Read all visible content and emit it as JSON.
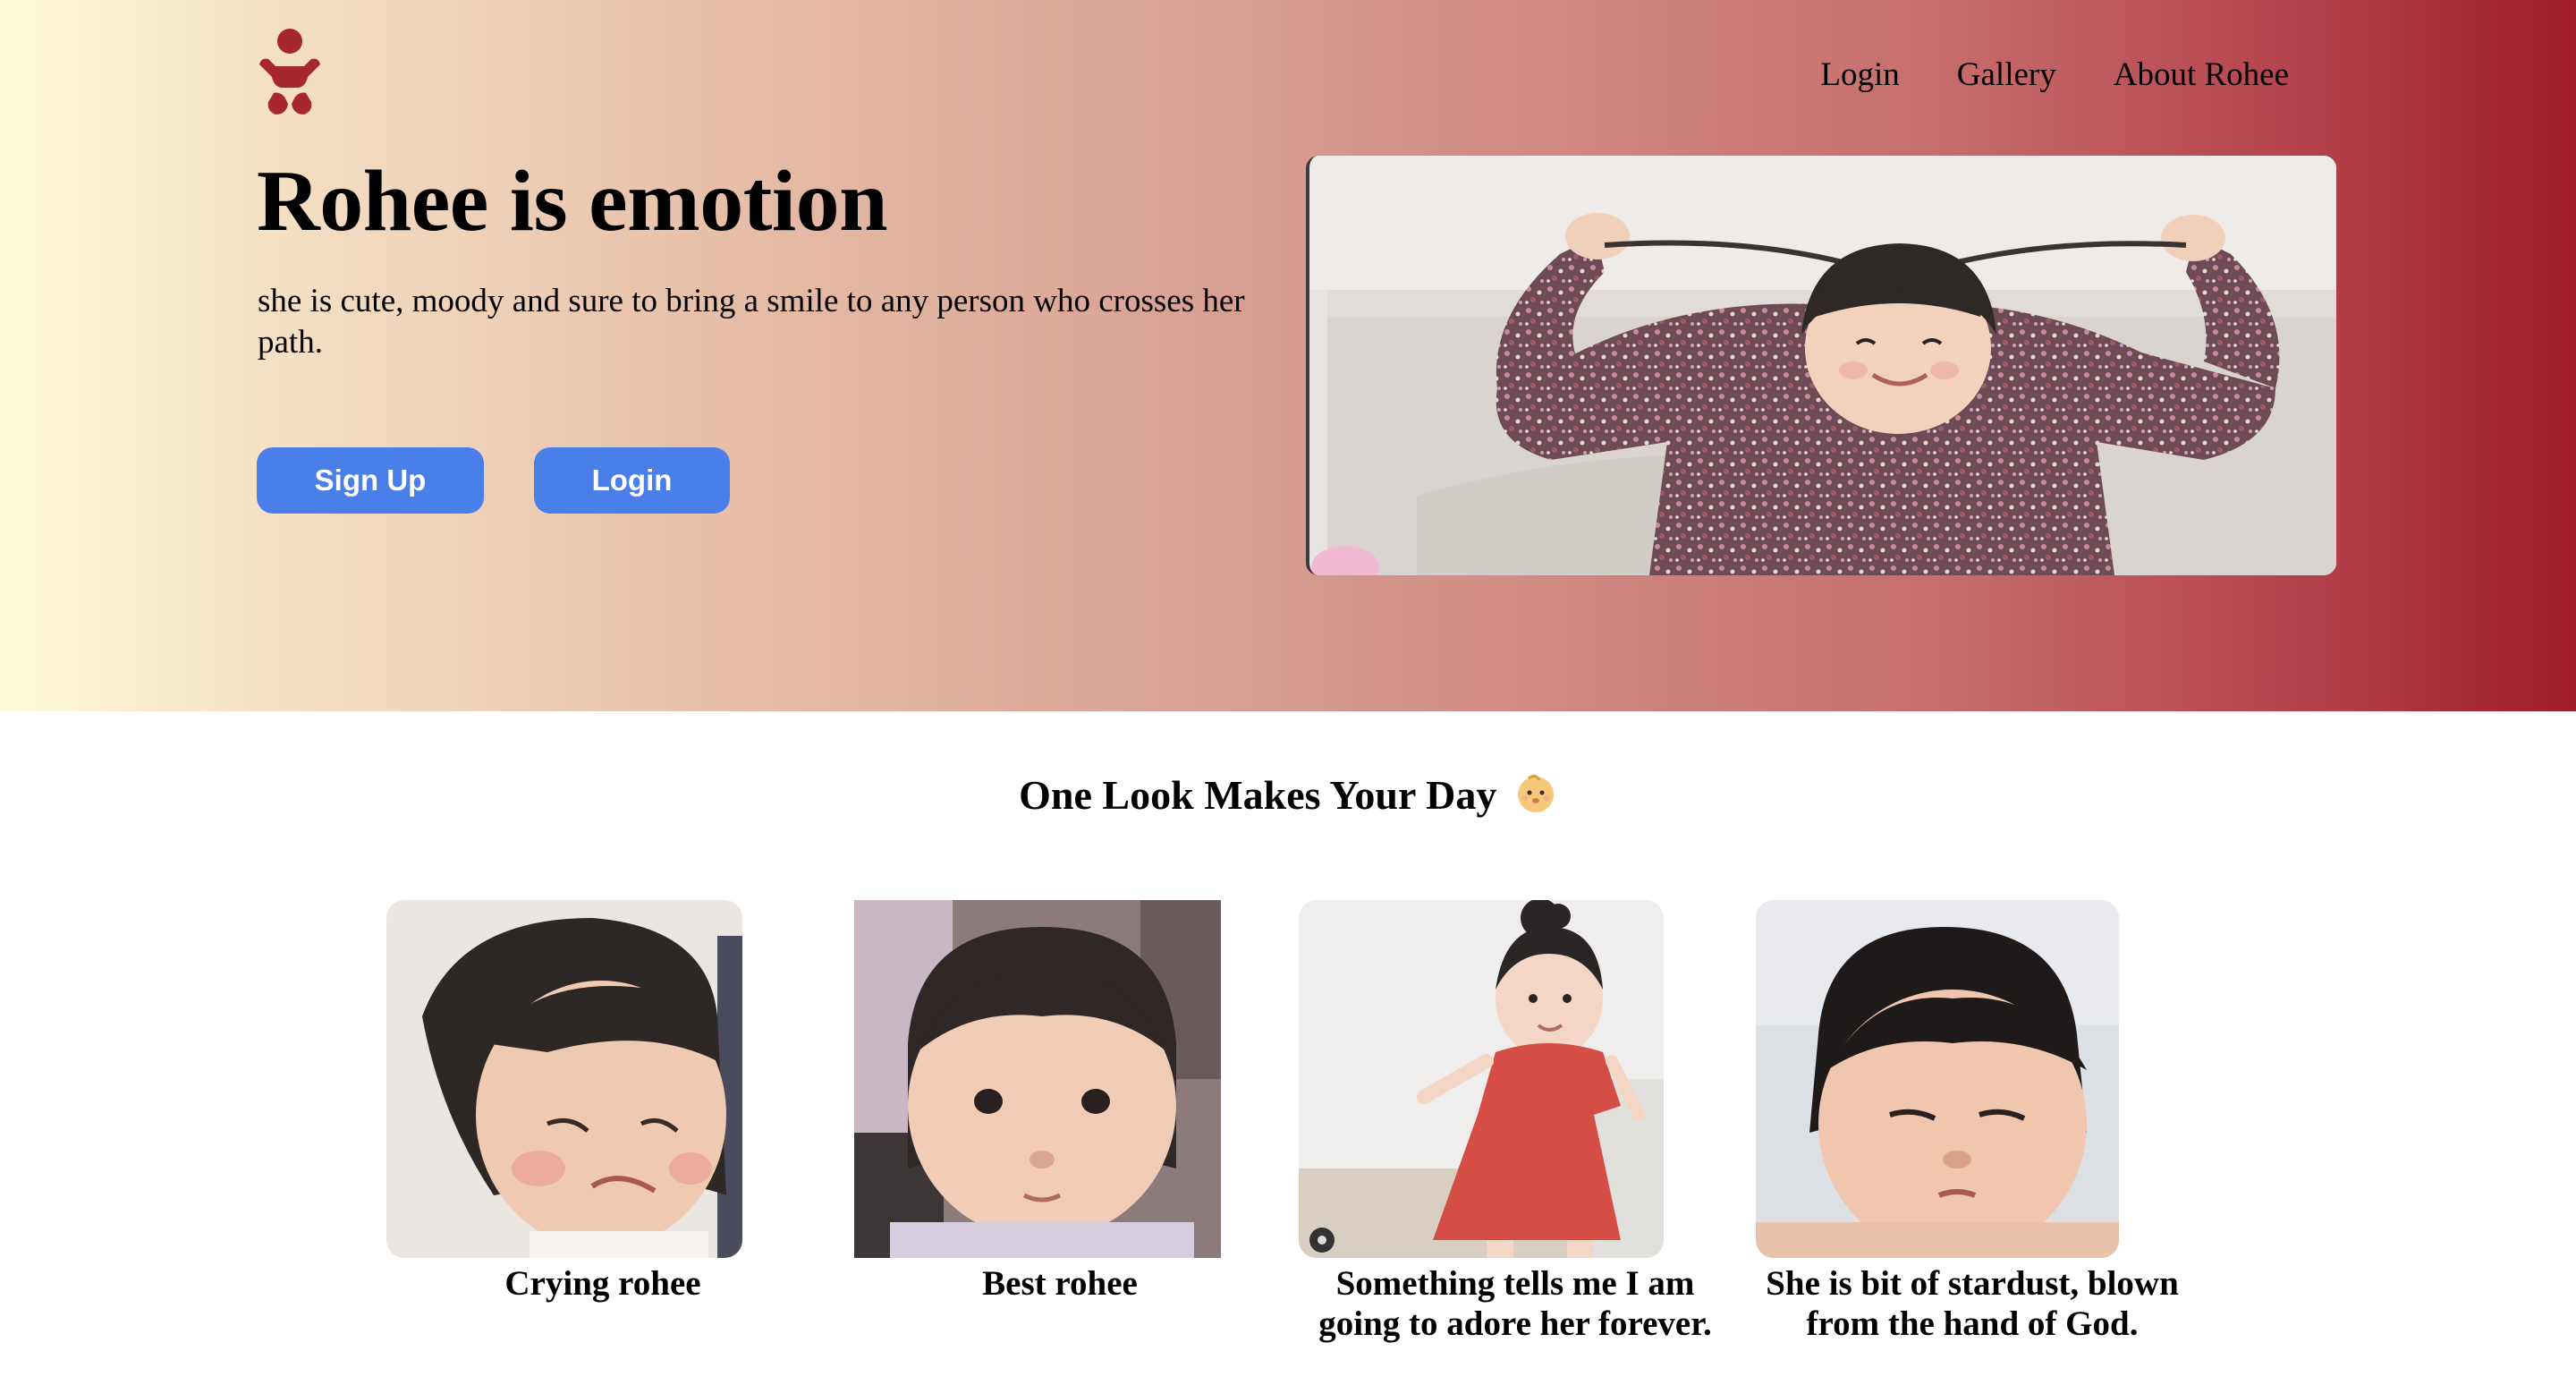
{
  "nav": {
    "items": [
      "Login",
      "Gallery",
      "About Rohee"
    ]
  },
  "hero": {
    "title": "Rohee is emotion",
    "subtitle": "she is cute, moody and sure to bring a smile to any person who crosses her path.",
    "signup_label": "Sign Up",
    "login_label": "Login"
  },
  "gallery": {
    "title": "One Look Makes Your Day",
    "cards": [
      {
        "caption": "Crying rohee"
      },
      {
        "caption": "Best rohee"
      },
      {
        "caption": "Something tells me I am going to adore her forever."
      },
      {
        "caption": "She is bit of stardust, blown from the hand of God."
      }
    ]
  },
  "colors": {
    "brand_red": "#a7272f",
    "button_blue": "#4a7ee8",
    "gradient_start": "#fefbd9",
    "gradient_end": "#9e1c28"
  },
  "icons": {
    "logo": "baby-icon",
    "emoji": "baby-face-emoji"
  }
}
